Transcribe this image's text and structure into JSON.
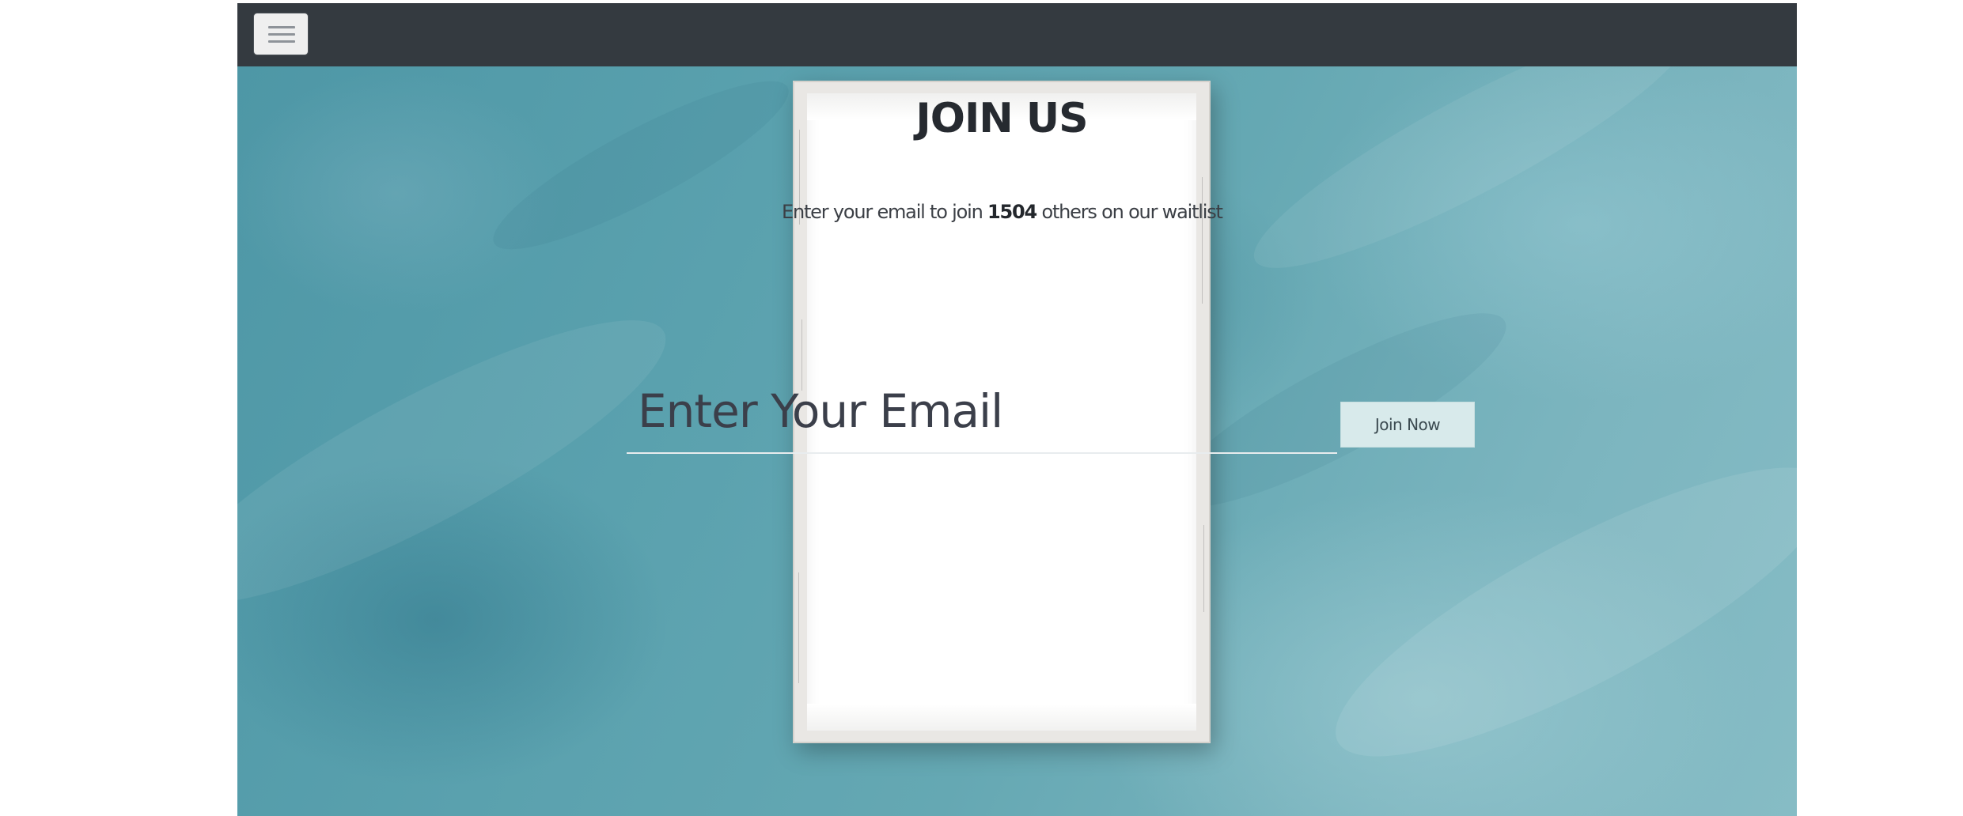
{
  "navbar": {
    "toggler_icon": "hamburger-menu-icon",
    "background_color": "#343a40"
  },
  "hero": {
    "title": "JOIN US",
    "subtitle": {
      "prefix": "Enter your email to join ",
      "count": "1504",
      "suffix": " others on our waitlist"
    },
    "email_input": {
      "placeholder": "Enter Your Email",
      "value": ""
    },
    "join_button_label": "Join Now",
    "colors": {
      "background_teal": "#5aa1ae",
      "button_background": "#d8eaeb",
      "card_background": "#ffffff"
    }
  }
}
